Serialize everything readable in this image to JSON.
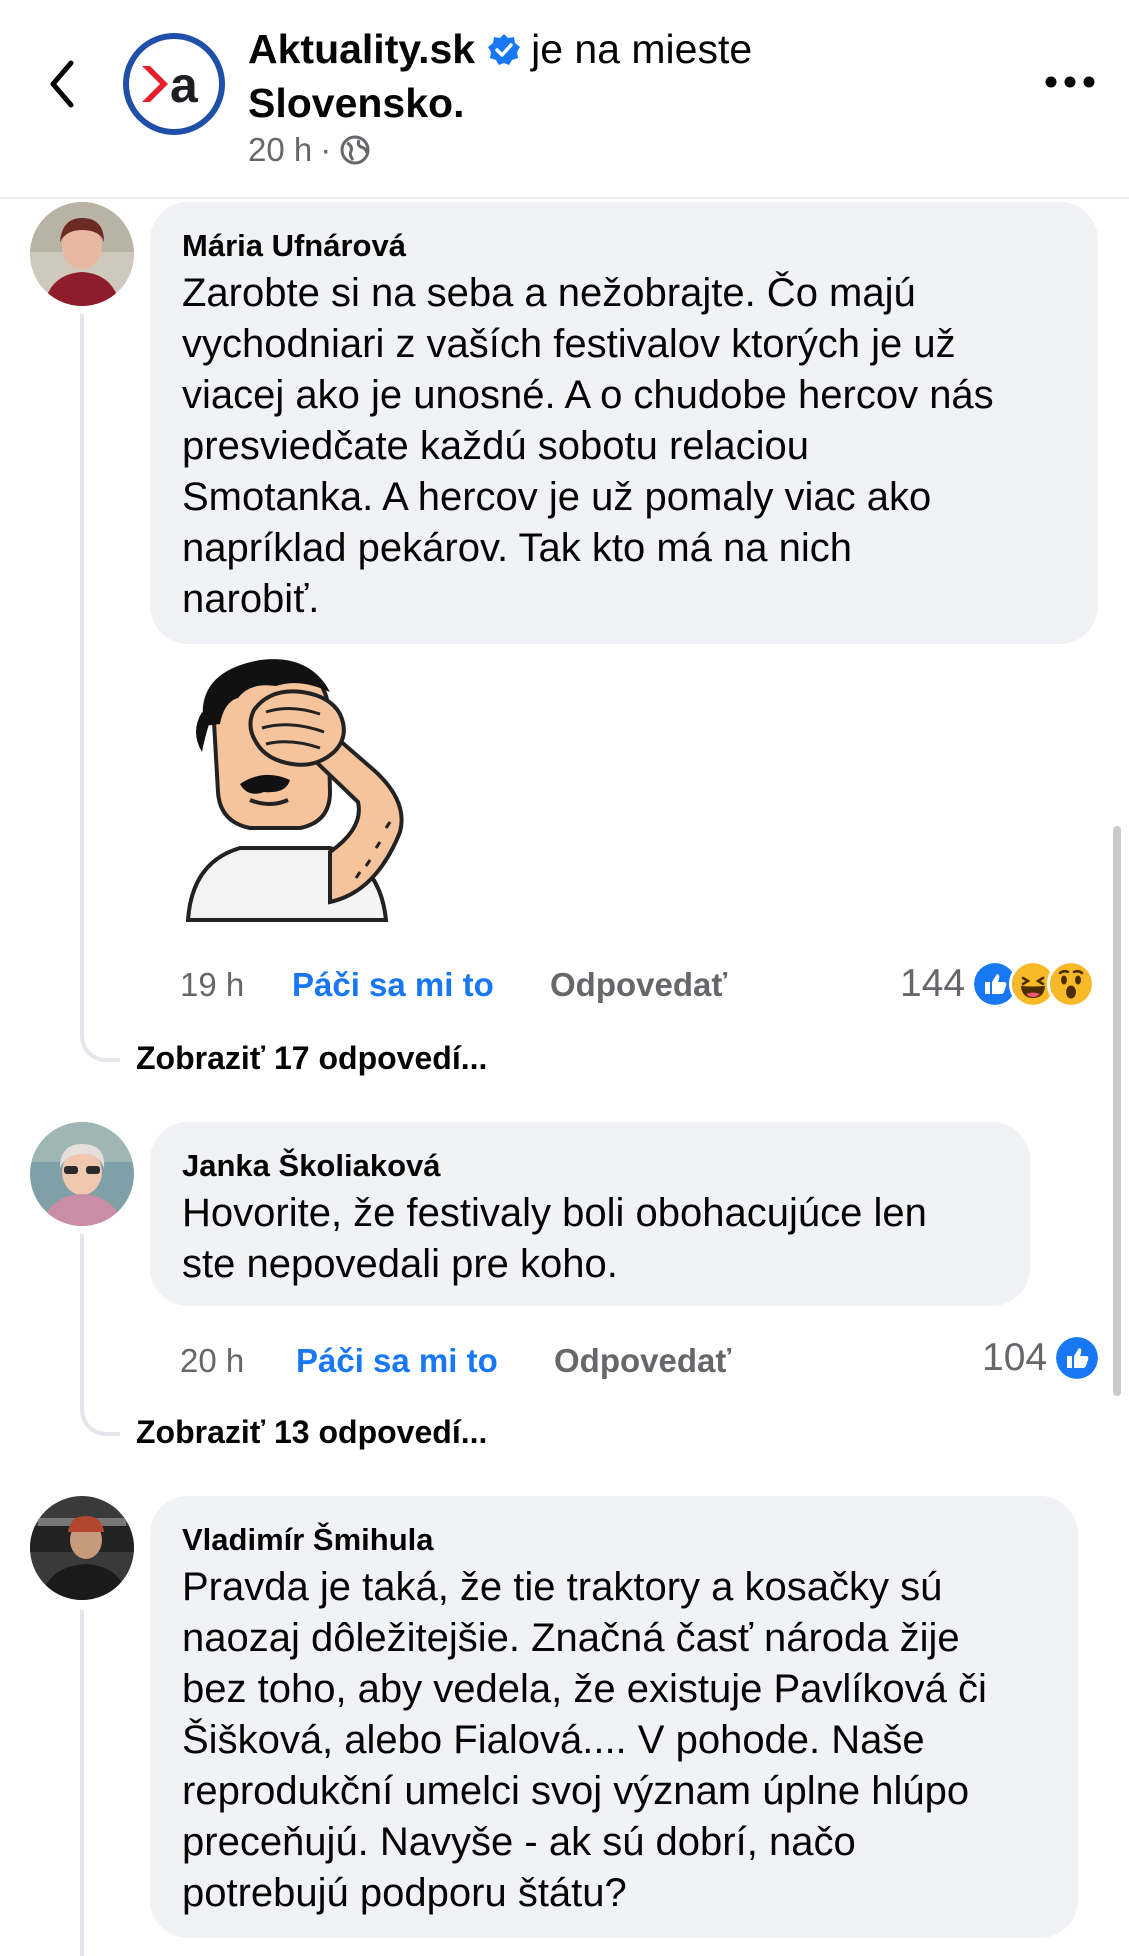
{
  "header": {
    "page_name": "Aktuality.sk",
    "location_prefix": "je na mieste",
    "location_name": "Slovensko.",
    "time": "20 h",
    "separator": "·",
    "icons": {
      "back": "chevron-left-icon",
      "logo": "aktuality-logo",
      "verified": "verified-badge-icon",
      "privacy": "globe-icon",
      "more": "more-horizontal-icon"
    }
  },
  "comments": [
    {
      "author": "Mária Ufnárová",
      "lines": [
        "Zarobte si na seba a nežobrajte. Čo majú",
        "vychodniari z vaších festivalov ktorých je už",
        "viacej ako je unosné. A o chudobe hercov nás",
        "presviedčate každú sobotu relaciou",
        "Smotanka. A hercov je už pomaly viac ako",
        "napríklad pekárov. Tak kto má na nich",
        "narobiť."
      ],
      "sticker": "facepalm-sticker",
      "time": "19 h",
      "like_label": "Páči sa mi to",
      "reply_label": "Odpovedať",
      "reaction_count": "144",
      "reactions": [
        "like",
        "haha",
        "wow"
      ],
      "view_replies": "Zobraziť 17 odpovedí..."
    },
    {
      "author": "Janka Školiaková",
      "lines": [
        "Hovorite, že festivaly boli obohacujúce len",
        "ste nepovedali pre koho."
      ],
      "time": "20 h",
      "like_label": "Páči sa mi to",
      "reply_label": "Odpovedať",
      "reaction_count": "104",
      "reactions": [
        "like"
      ],
      "view_replies": "Zobraziť 13 odpovedí..."
    },
    {
      "author": "Vladimír Šmihula",
      "lines": [
        "Pravda je taká, že tie traktory a kosačky sú",
        "naozaj dôležitejšie. Značná časť národa žije",
        "bez toho, aby vedela, že existuje Pavlíková či",
        "Šišková, alebo Fialová.... V pohode. Naše",
        "reprodukční umelci svoj význam úplne hlúpo",
        "preceňujú. Navyše - ak sú dobrí, načo",
        "potrebujú podporu štátu?"
      ]
    }
  ],
  "colors": {
    "accent": "#1877f2",
    "bubble": "#f0f2f5",
    "secondary_text": "#65676b",
    "logo_red": "#e4202e",
    "logo_blue": "#1f4fa8"
  }
}
